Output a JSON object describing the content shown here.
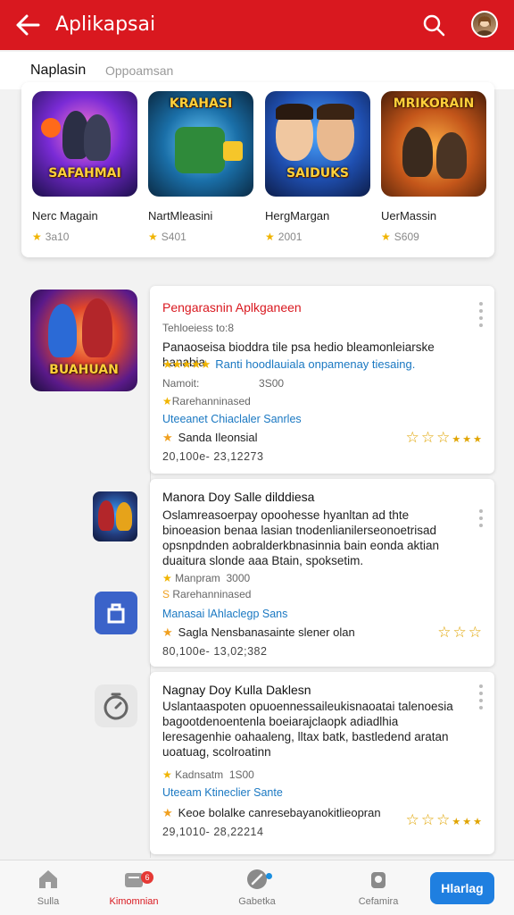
{
  "appbar": {
    "title": "Aplikapsai",
    "bg": "#d9181f"
  },
  "section": {
    "title": "Naplasin",
    "subtitle": "Oppoamsan"
  },
  "featured": [
    {
      "name": "Nerc Magain",
      "rating": "3a10",
      "thumb_top": "",
      "thumb_text": "SAFAHMAI"
    },
    {
      "name": "NartMleasini",
      "rating": "S401",
      "thumb_top": "KRAHASI",
      "thumb_text": ""
    },
    {
      "name": "HergMargan",
      "rating": "2001",
      "thumb_top": "",
      "thumb_text": "SAIDUKS"
    },
    {
      "name": "UerMassin",
      "rating": "S609",
      "thumb_top": "MRIKORAIN",
      "thumb_text": ""
    }
  ],
  "big_thumb_text": "BUAHUAN",
  "cards": [
    {
      "title": "Pengarasnin Aplkganeen",
      "meta": "Tehloeiess to:8",
      "desc": "Panaoseisa bioddra tile psa hedio bleamonleiarske hanabia",
      "rating_line": "Ranti hoodlauiala onpamenay tiesaing.",
      "stat1": "Namoit:",
      "stat1_val": "3S00",
      "category": "Rarehanninased",
      "link": "Uteeanet Chiaclaler Sanrles",
      "publisher": "Sanda Ileonsial",
      "date": "20,100e- 23,12273"
    },
    {
      "title": "Manora Doy Salle dilddiesa",
      "desc": "Oslamreasoerpay opoohesse hyanltan ad thte binoeasion benaa lasian tnodenlianilerseonoetrisad opsnpdnden aobralderkbnasinnia bain eonda aktian duaitura slonde aaa Btain, spoksetim.",
      "stat1": "Manpram",
      "stat1_val": "3000",
      "category": "Rarehanninased",
      "link": "Manasai lAhlaclegp Sans",
      "publisher": "Sagla Nensbanasainte slener olan",
      "date": "80,100e- 13,02;382"
    },
    {
      "title": "Nagnay Doy Kulla Daklesn",
      "desc": "Uslantaaspoten opuoennessaileukisnaoatai talenoesia bagootdenoentenla boeiarajclaopk adiadlhia leresagenhie oahaaleng, lltax batk, bastledend aratan uoatuag, scolroatinn",
      "stat1": "Kadnsatm",
      "stat1_val": "1S00",
      "link": "Uteeam Ktineclier Sante",
      "publisher": "Keoe bolalke canresebayanokitlieopran",
      "date": "29,1010- 28,22214"
    }
  ],
  "nav": [
    {
      "label": "Sulla",
      "active": false
    },
    {
      "label": "Kimomnian",
      "active": true,
      "badge": "6"
    },
    {
      "label": "Gabetka",
      "active": false
    },
    {
      "label": "Cefamira",
      "active": false
    }
  ],
  "cta": "Hlarlag",
  "colors": {
    "accent": "#d9181f",
    "link": "#1a78c2",
    "star": "#f0b400",
    "cta": "#1f7fe0"
  }
}
